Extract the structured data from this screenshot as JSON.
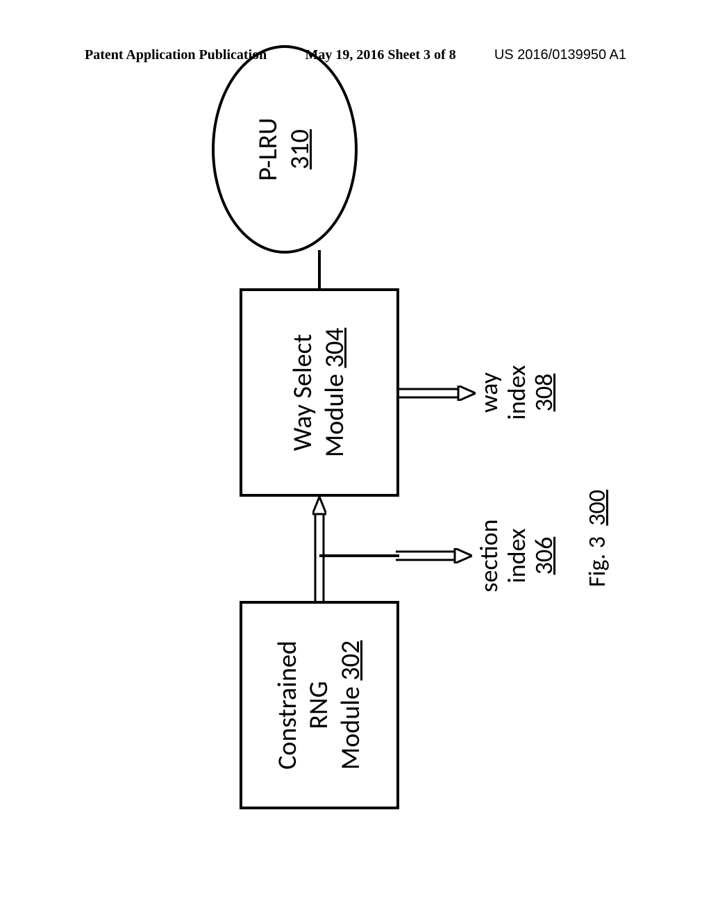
{
  "header": {
    "left": "Patent Application Publication",
    "center": "May 19, 2016  Sheet 3 of 8",
    "right": "US 2016/0139950 A1"
  },
  "blocks": {
    "rng": {
      "line1": "Constrained",
      "line2": "RNG",
      "module": "Module",
      "ref": "302"
    },
    "way": {
      "line1": "Way Select",
      "module": "Module",
      "ref": "304"
    },
    "plru": {
      "line1": "P-LRU",
      "ref": "310"
    }
  },
  "labels": {
    "section": {
      "line1": "section",
      "line2": "index",
      "ref": "306"
    },
    "way": {
      "line1": "way",
      "line2": "index",
      "ref": "308"
    }
  },
  "figure": {
    "prefix": "Fig. 3",
    "ref": "300"
  }
}
